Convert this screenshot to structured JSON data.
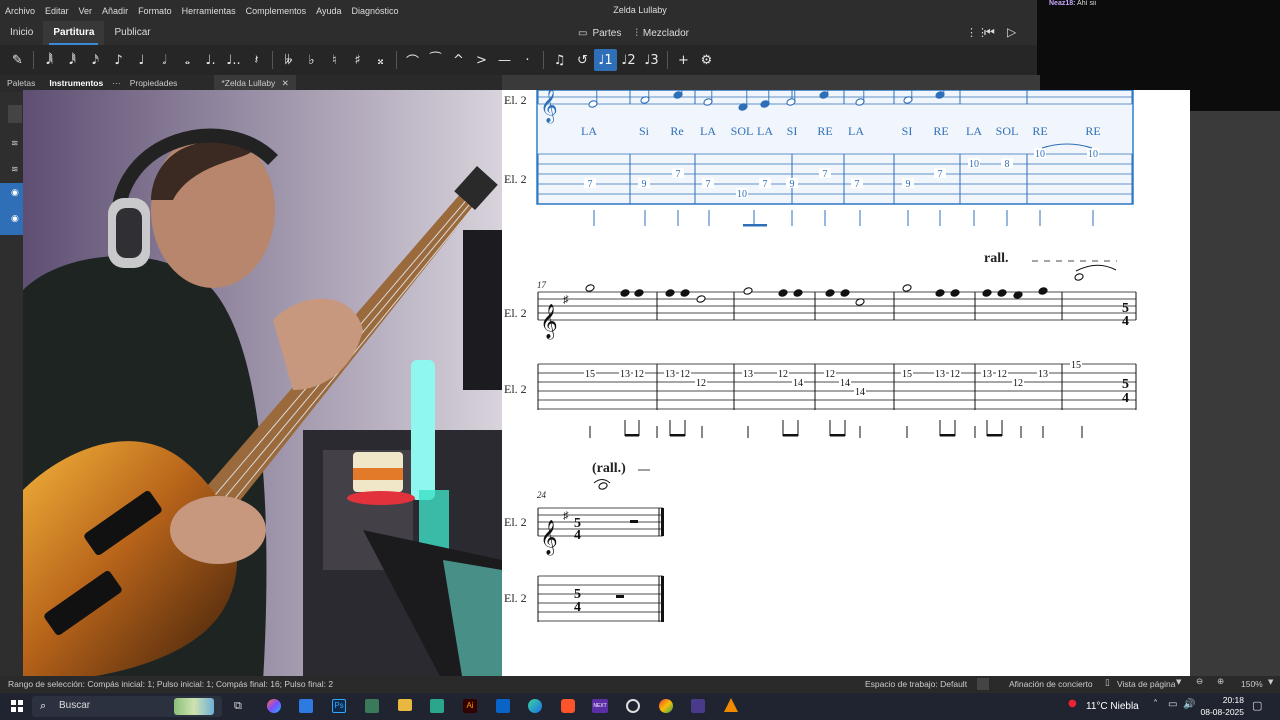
{
  "app": {
    "title": "Zelda Lullaby",
    "menus": [
      "Archivo",
      "Editar",
      "Ver",
      "Añadir",
      "Formato",
      "Herramientas",
      "Complementos",
      "Ayuda",
      "Diagnóstico"
    ]
  },
  "nav": {
    "tabs": [
      "Inicio",
      "Partitura",
      "Publicar"
    ],
    "active": "Partitura",
    "parts_label": "Partes",
    "mixer_label": "Mezclador"
  },
  "chat": {
    "user": "Neaz18:",
    "message": "Ahí sii"
  },
  "toolbar": {
    "buttons": [
      "pencil-icon",
      "64th-note-icon",
      "32nd-note-icon",
      "16th-note-icon",
      "eighth-note-icon",
      "quarter-note-icon",
      "half-note-icon",
      "whole-note-icon",
      "dotted-icon",
      "double-dotted-icon",
      "rest-icon",
      "double-flat-icon",
      "flat-icon",
      "natural-icon",
      "sharp-icon",
      "double-sharp-icon",
      "tie-icon",
      "slur-icon",
      "marcato-icon",
      "accent-icon",
      "tenuto-icon",
      "staccato-icon",
      "tuplet-icon",
      "flip-icon",
      "voice-1-icon",
      "voice-2-icon",
      "voice-3-icon",
      "add-icon",
      "settings-icon"
    ],
    "glyphs": [
      "✎",
      "𝅘𝅥𝅲",
      "𝅘𝅥𝅱",
      "𝅘𝅥𝅯",
      "♪",
      "♩",
      "𝅗𝅥",
      "𝅝",
      "♩.",
      "♩..",
      "𝄽",
      "𝄫",
      "♭",
      "♮",
      "♯",
      "𝄪",
      "⌒",
      "⁀",
      "^",
      ">",
      "—",
      "·",
      "♫",
      "↺",
      "♩1",
      "♩2",
      "♩3",
      "+",
      "⚙"
    ]
  },
  "panel": {
    "tabs": [
      "Paletas",
      "Instrumentos",
      "Propiedades"
    ],
    "active": "Instrumentos",
    "document_tab": "*Zelda Lullaby"
  },
  "score": {
    "instrument_label": "El. 2",
    "system1": {
      "lyrics": [
        "LA",
        "Si",
        "Re",
        "LA",
        "SOL",
        "LA",
        "SI",
        "RE",
        "LA",
        "SI",
        "RE",
        "LA",
        "SOL",
        "RE",
        "RE"
      ],
      "tab": [
        "7",
        "9",
        "7",
        "7",
        "10",
        "7",
        "9",
        "7",
        "7",
        "9",
        "7",
        "10",
        "8",
        "10",
        "10"
      ]
    },
    "system2": {
      "measure_number": "17",
      "tempo_text": "rall.",
      "tab": [
        "15",
        "13",
        "12",
        "13",
        "12",
        "12",
        "13",
        "12",
        "14",
        "12",
        "14",
        "14",
        "15",
        "13",
        "12",
        "13",
        "12",
        "12",
        "13",
        "15"
      ],
      "time_sig_top": "5",
      "time_sig_bottom": "4"
    },
    "system3": {
      "measure_number": "24",
      "tempo_text": "(rall.)",
      "time_sig_top": "5",
      "time_sig_bottom": "4"
    }
  },
  "status": {
    "selection": "Rango de selección: Compás inicial: 1; Pulso inicial: 1; Compás final: 16; Pulso final: 2",
    "workspace": "Espacio de trabajo: Default",
    "concert_pitch": "Afinación de concierto",
    "page_view": "Vista de página",
    "zoom": "150%"
  },
  "taskbar": {
    "search_placeholder": "Buscar",
    "weather": "11°C  Niebla",
    "time": "20:18",
    "date": "08-08-2025"
  }
}
